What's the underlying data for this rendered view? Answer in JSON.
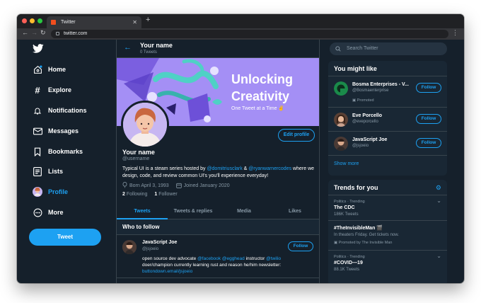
{
  "browser": {
    "tab_title": "Twitter",
    "url": "twitter.com",
    "colors": {
      "close": "#ff5f57",
      "minimize": "#febc2e",
      "maximize": "#28c840"
    }
  },
  "sidebar": {
    "items": [
      {
        "label": "Home",
        "icon": "home-icon"
      },
      {
        "label": "Explore",
        "icon": "hashtag-icon"
      },
      {
        "label": "Notifications",
        "icon": "bell-icon"
      },
      {
        "label": "Messages",
        "icon": "envelope-icon"
      },
      {
        "label": "Bookmarks",
        "icon": "bookmark-icon"
      },
      {
        "label": "Lists",
        "icon": "list-icon"
      },
      {
        "label": "Profile",
        "icon": "avatar"
      },
      {
        "label": "More",
        "icon": "more-icon"
      }
    ],
    "tweet_button": "Tweet"
  },
  "header": {
    "title": "Your name",
    "subtitle": "0 Tweets"
  },
  "banner": {
    "title_line1": "Unlocking",
    "title_line2": "Creativity",
    "subtitle": "One Tweet at a Time ✌️"
  },
  "profile": {
    "edit_button": "Edit profile",
    "name": "Your name",
    "handle": "@username",
    "bio_part1": "Typical UI is a steam series hosted by ",
    "bio_link1": "@domitriusclark",
    "bio_part2": " & ",
    "bio_link2": "@ryanwarnercodes",
    "bio_part3": " where we design, code, and review common UI's you'll experience everyday!",
    "born": "Born April 3, 1993",
    "joined": "Joined January 2020",
    "following_count": "2",
    "following_label": " Following",
    "followers_count": "1",
    "followers_label": " Follower"
  },
  "tabs": [
    "Tweets",
    "Tweets & replies",
    "Media",
    "Likes"
  ],
  "who_to_follow": {
    "title": "Who to follow",
    "name": "JavaScript Joe",
    "handle": "@jsjoeio",
    "follow": "Follow",
    "text_part1": "open source dev advocate ",
    "link1": "@facebook",
    "text_part2": " ",
    "link2": "@egghead",
    "text_part3": " instructor ",
    "link3": "@twilio",
    "text_part4": " doer/champion currently learning rust and reason he/him newsletter: ",
    "link4": "buttondown.email/jsjoeio"
  },
  "right": {
    "search_placeholder": "Search Twitter",
    "might_like": {
      "title": "You might like",
      "items": [
        {
          "name": "Bosma Enterprises - V...",
          "handle": "@Bosmaenterprise",
          "promoted": "Promoted",
          "follow": "Follow"
        },
        {
          "name": "Eve Porcello",
          "handle": "@eveporcello",
          "follow": "Follow"
        },
        {
          "name": "JavaScript Joe",
          "handle": "@jsjoeio",
          "follow": "Follow"
        }
      ],
      "show_more": "Show more"
    },
    "trends": {
      "title": "Trends for you",
      "items": [
        {
          "context": "Politics · Trending",
          "topic": "The CDC",
          "count": "186K Tweets"
        },
        {
          "context": "",
          "topic": "#TheInvisibleMan 🎬",
          "count": "In theaters Friday. Get tickets now.",
          "promoted": "Promoted by The Invisible Man"
        },
        {
          "context": "Politics · Trending",
          "topic": "#COVID—19",
          "count": "88.1K Tweets"
        }
      ]
    }
  }
}
